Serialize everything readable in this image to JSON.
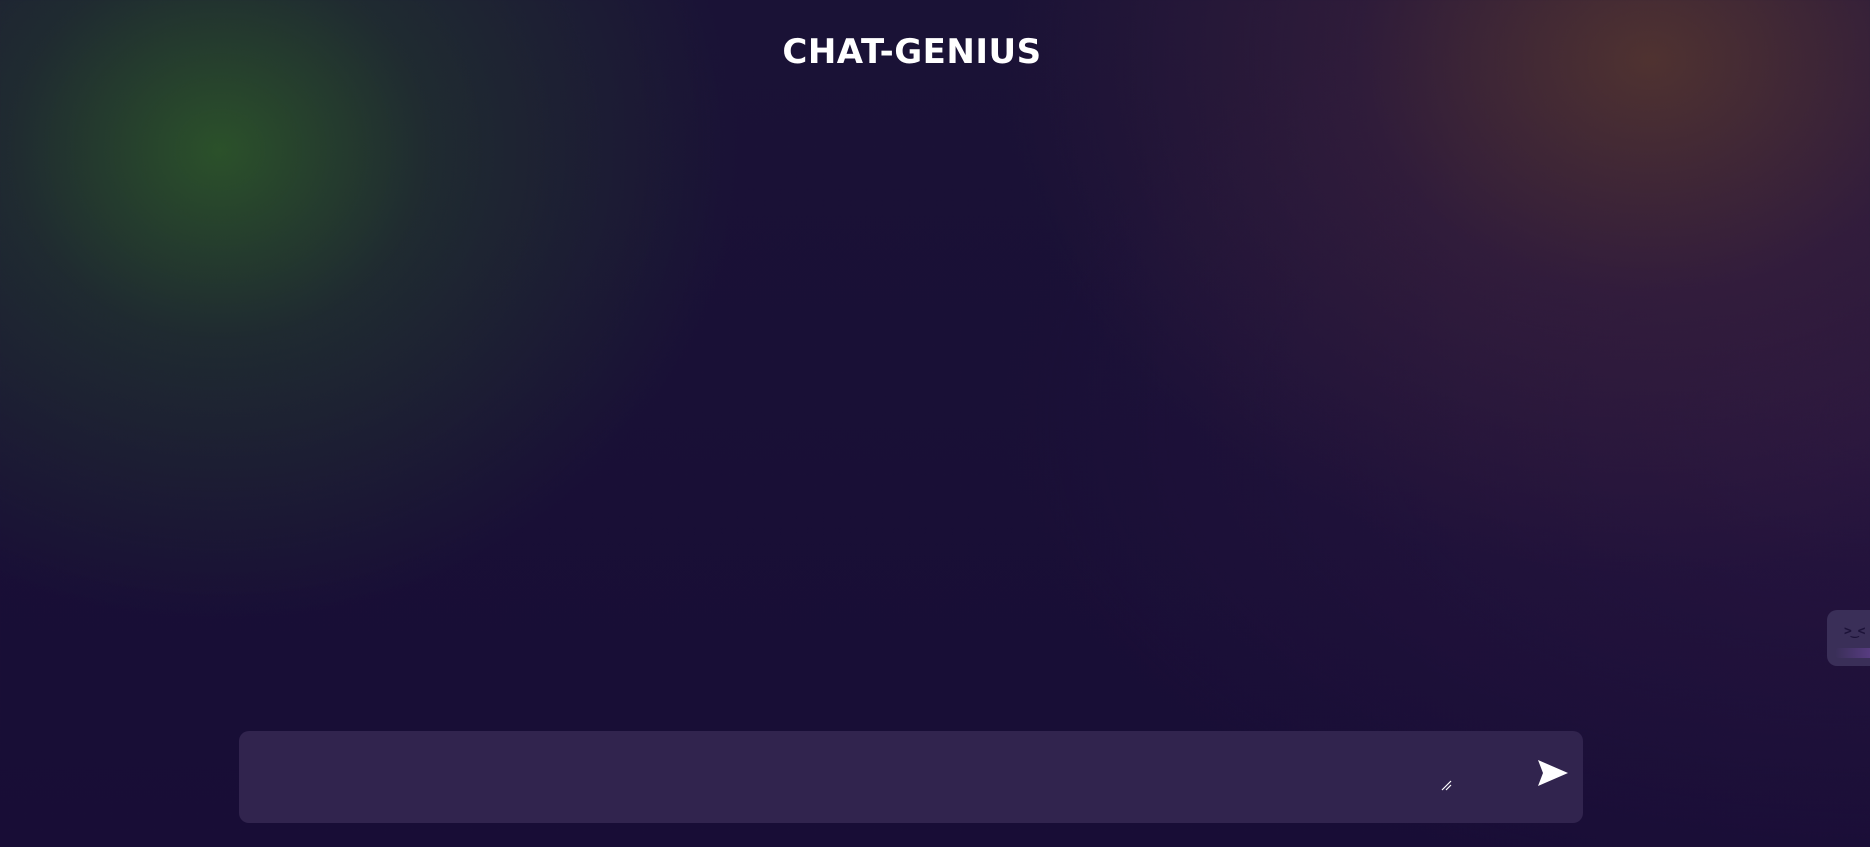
{
  "app": {
    "title": "CHAT-GENIUS"
  },
  "composer": {
    "value": "",
    "placeholder": "",
    "send_icon": "send-icon",
    "resize_icon": "resize-handle-icon"
  },
  "side_widget": {
    "face": ">‿<"
  },
  "colors": {
    "background": "#180d36",
    "composer_bg": "#31244e",
    "title": "#ffffff"
  }
}
